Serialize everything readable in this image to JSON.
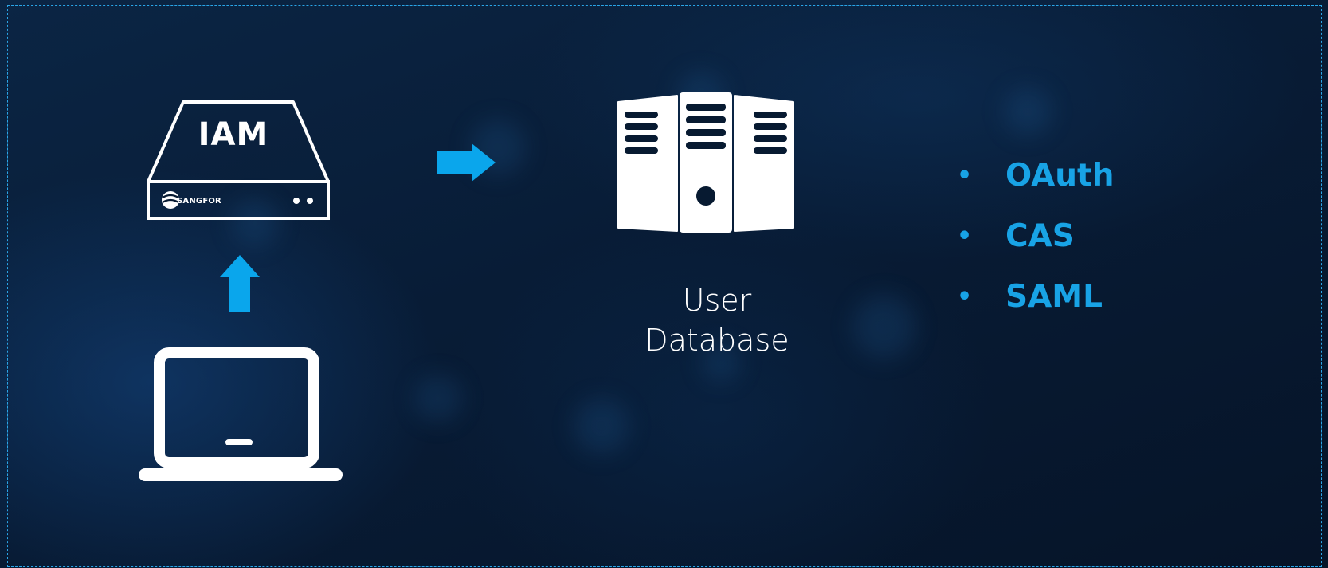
{
  "diagram": {
    "iam_device": {
      "label": "IAM",
      "brand": "SANGFOR",
      "icon": "iam-appliance-icon"
    },
    "arrow_up": {
      "icon": "arrow-up-icon",
      "color": "#0aa6ec"
    },
    "arrow_right": {
      "icon": "arrow-right-icon",
      "color": "#0aa6ec"
    },
    "laptop": {
      "icon": "laptop-icon"
    },
    "database": {
      "icon": "database-server-icon",
      "label_line1": "User",
      "label_line2": "Database"
    },
    "protocols": [
      {
        "label": "OAuth"
      },
      {
        "label": "CAS"
      },
      {
        "label": "SAML"
      }
    ]
  },
  "colors": {
    "background": "#071a31",
    "accent": "#18a3e6",
    "icon": "#ffffff",
    "frame_border": "#2aa6e8"
  }
}
